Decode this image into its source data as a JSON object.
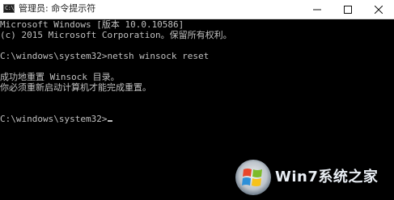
{
  "window": {
    "title": "管理员: 命令提示符",
    "app_icon_glyph": "C:\\",
    "controls": {
      "minimize": "minimize-icon",
      "maximize": "maximize-icon",
      "close": "close-icon"
    }
  },
  "console": {
    "lines": [
      "Microsoft Windows [版本 10.0.10586]",
      "(c) 2015 Microsoft Corporation。保留所有权利。",
      "",
      "C:\\windows\\system32>netsh winsock reset",
      "",
      "成功地重置 Winsock 目录。",
      "你必须重新启动计算机才能完成重置。",
      "",
      "",
      "C:\\windows\\system32>"
    ],
    "colors": {
      "background": "#000000",
      "text": "#c0c0c0"
    }
  },
  "watermark": {
    "text": "Win7系统之家",
    "logo": "windows-7-logo"
  }
}
